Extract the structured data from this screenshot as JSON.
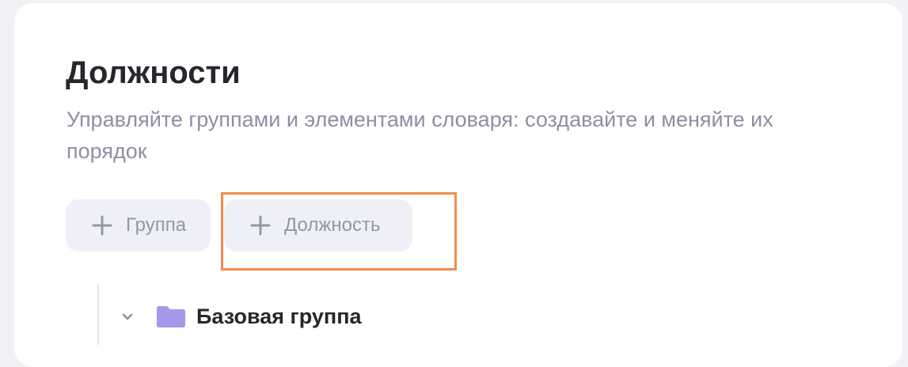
{
  "page": {
    "title": "Должности",
    "subtitle": "Управляйте группами и элементами словаря: создавайте и меняйте их порядок"
  },
  "toolbar": {
    "add_group_label": "Группа",
    "add_position_label": "Должность"
  },
  "tree": {
    "groups": [
      {
        "name": "Базовая группа",
        "expanded": true
      }
    ]
  },
  "colors": {
    "highlight": "#f38b4a",
    "button_bg": "#efeff7",
    "folder": "#a797e8"
  },
  "icons": {
    "add": "plus-icon",
    "expand": "chevron-down-icon",
    "group": "folder-icon"
  }
}
